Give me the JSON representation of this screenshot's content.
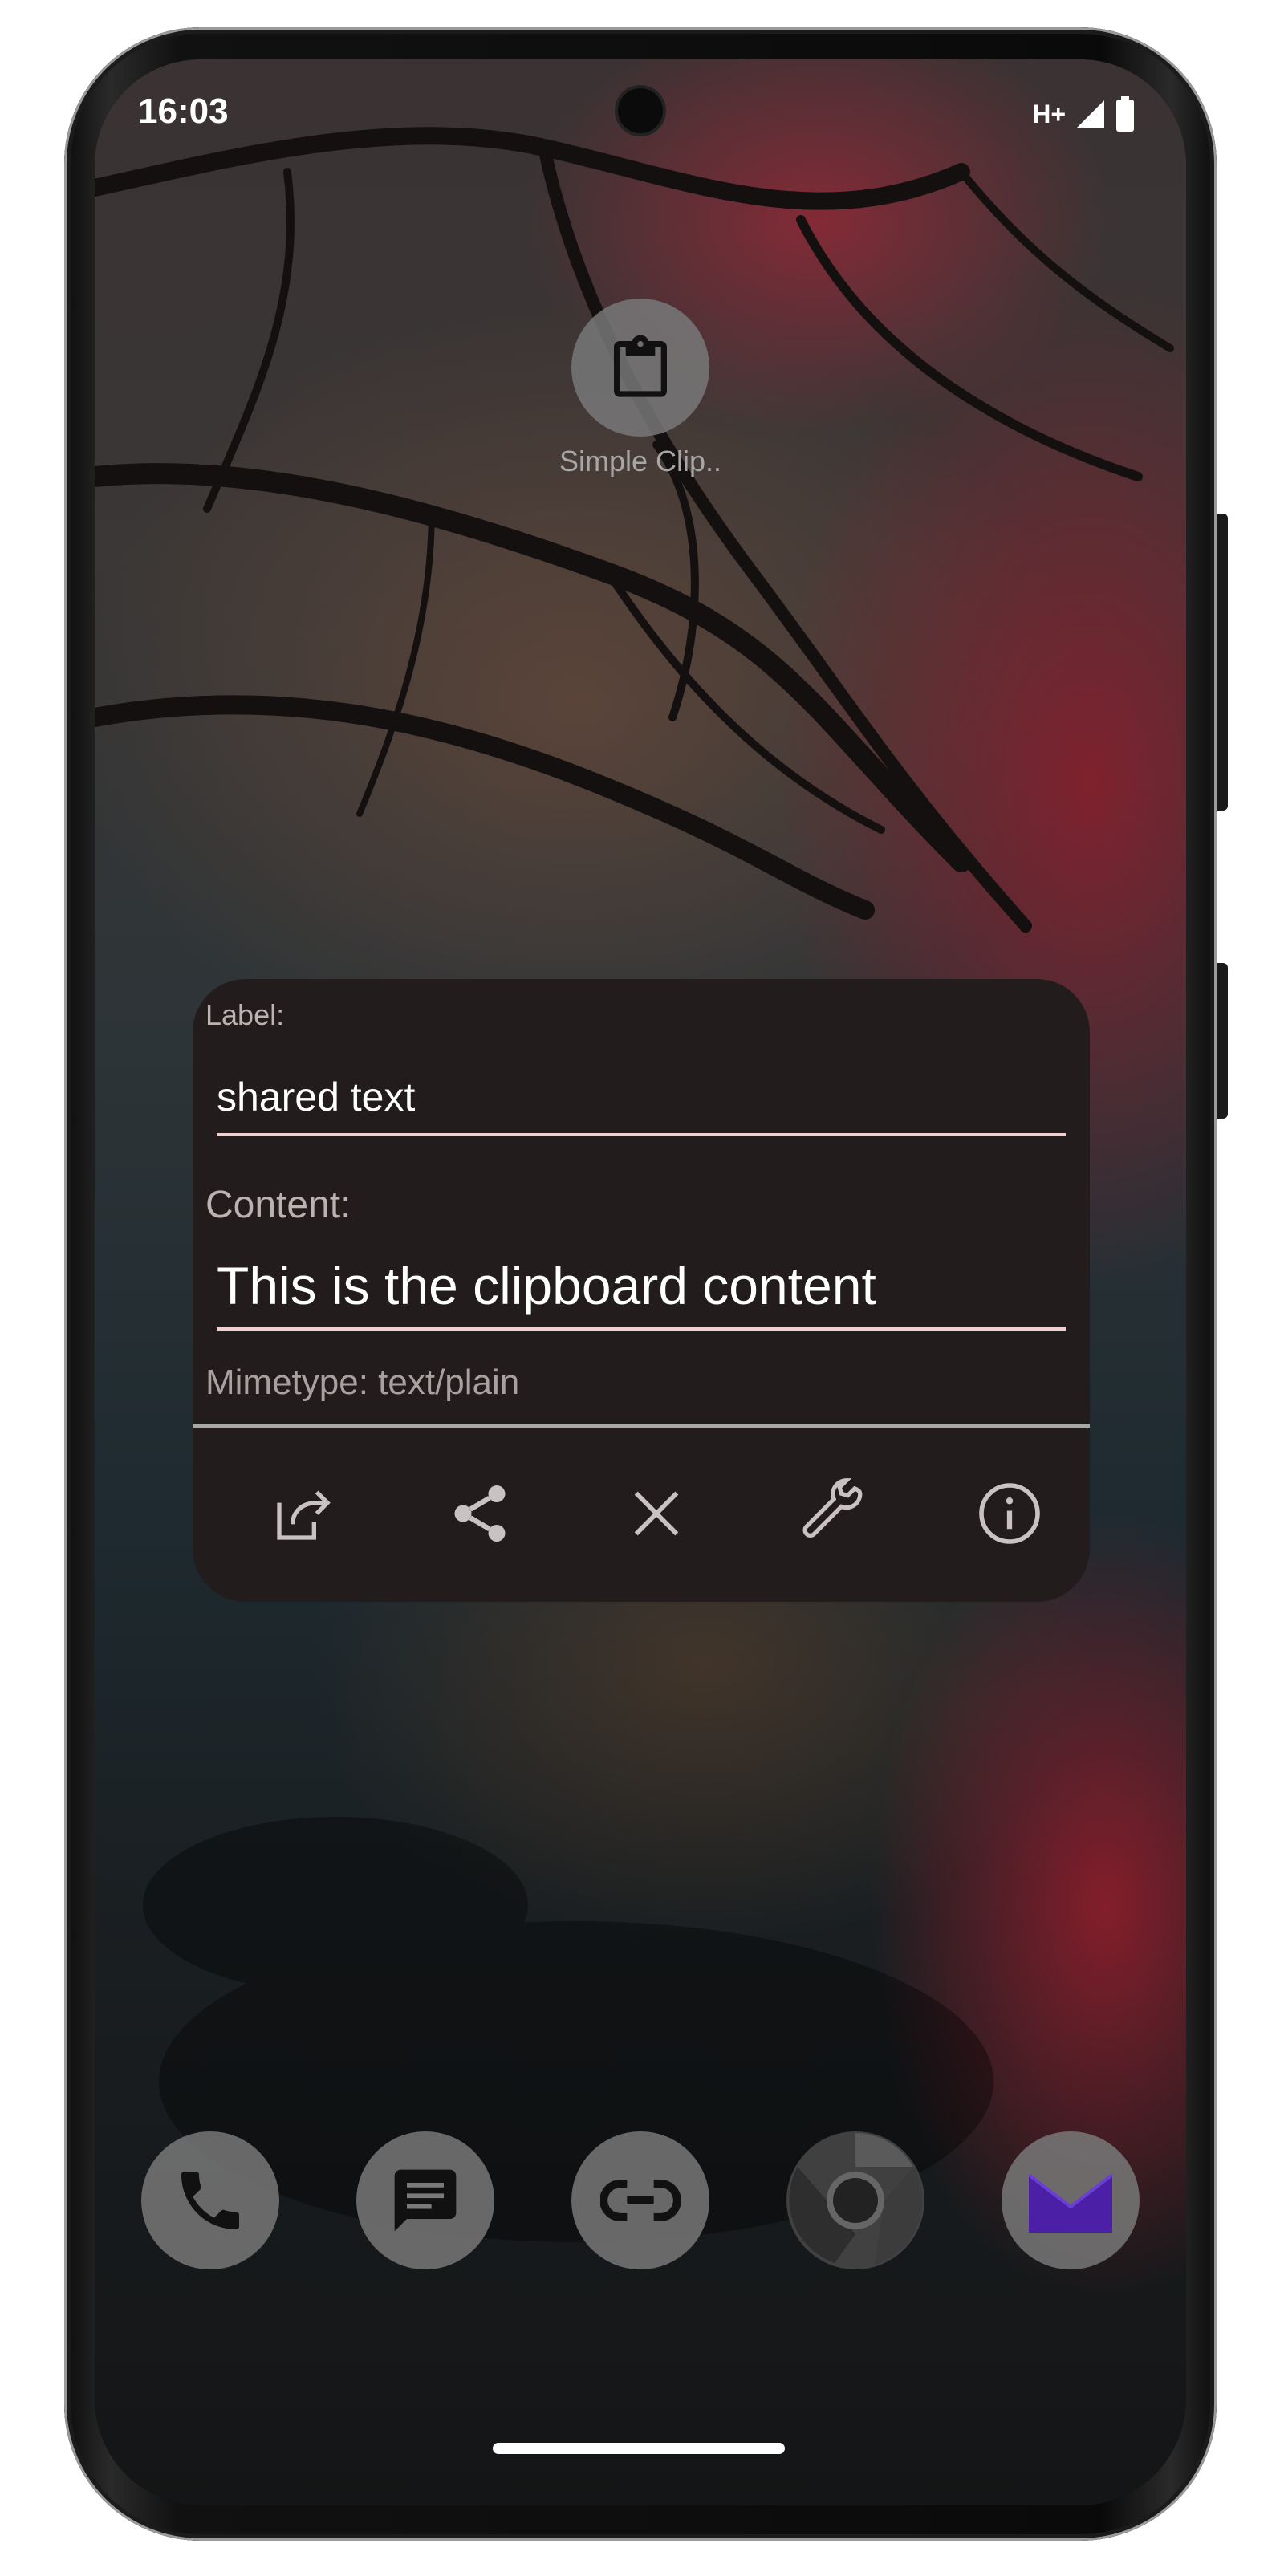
{
  "status_bar": {
    "time": "16:03",
    "network_type": "H+",
    "icons": [
      "signal-icon",
      "battery-icon"
    ]
  },
  "home": {
    "app_label": "Simple Clip..",
    "app_icon": "clipboard-icon"
  },
  "popup": {
    "label_caption": "Label:",
    "label_value": "shared text",
    "content_caption": "Content:",
    "content_value": "This is the clipboard content",
    "mimetype": "Mimetype: text/plain",
    "actions": [
      "open-external-icon",
      "share-icon",
      "close-icon",
      "wrench-icon",
      "info-icon"
    ]
  },
  "dock": {
    "apps": [
      "phone-icon",
      "messages-icon",
      "link-icon",
      "chrome-icon",
      "mail-icon"
    ]
  },
  "colors": {
    "popup_bg": "#231c1c",
    "field_underline": "#efd0d0",
    "icon_gray": "#c9c2c2",
    "mail_purple": "#4b1fa6"
  }
}
